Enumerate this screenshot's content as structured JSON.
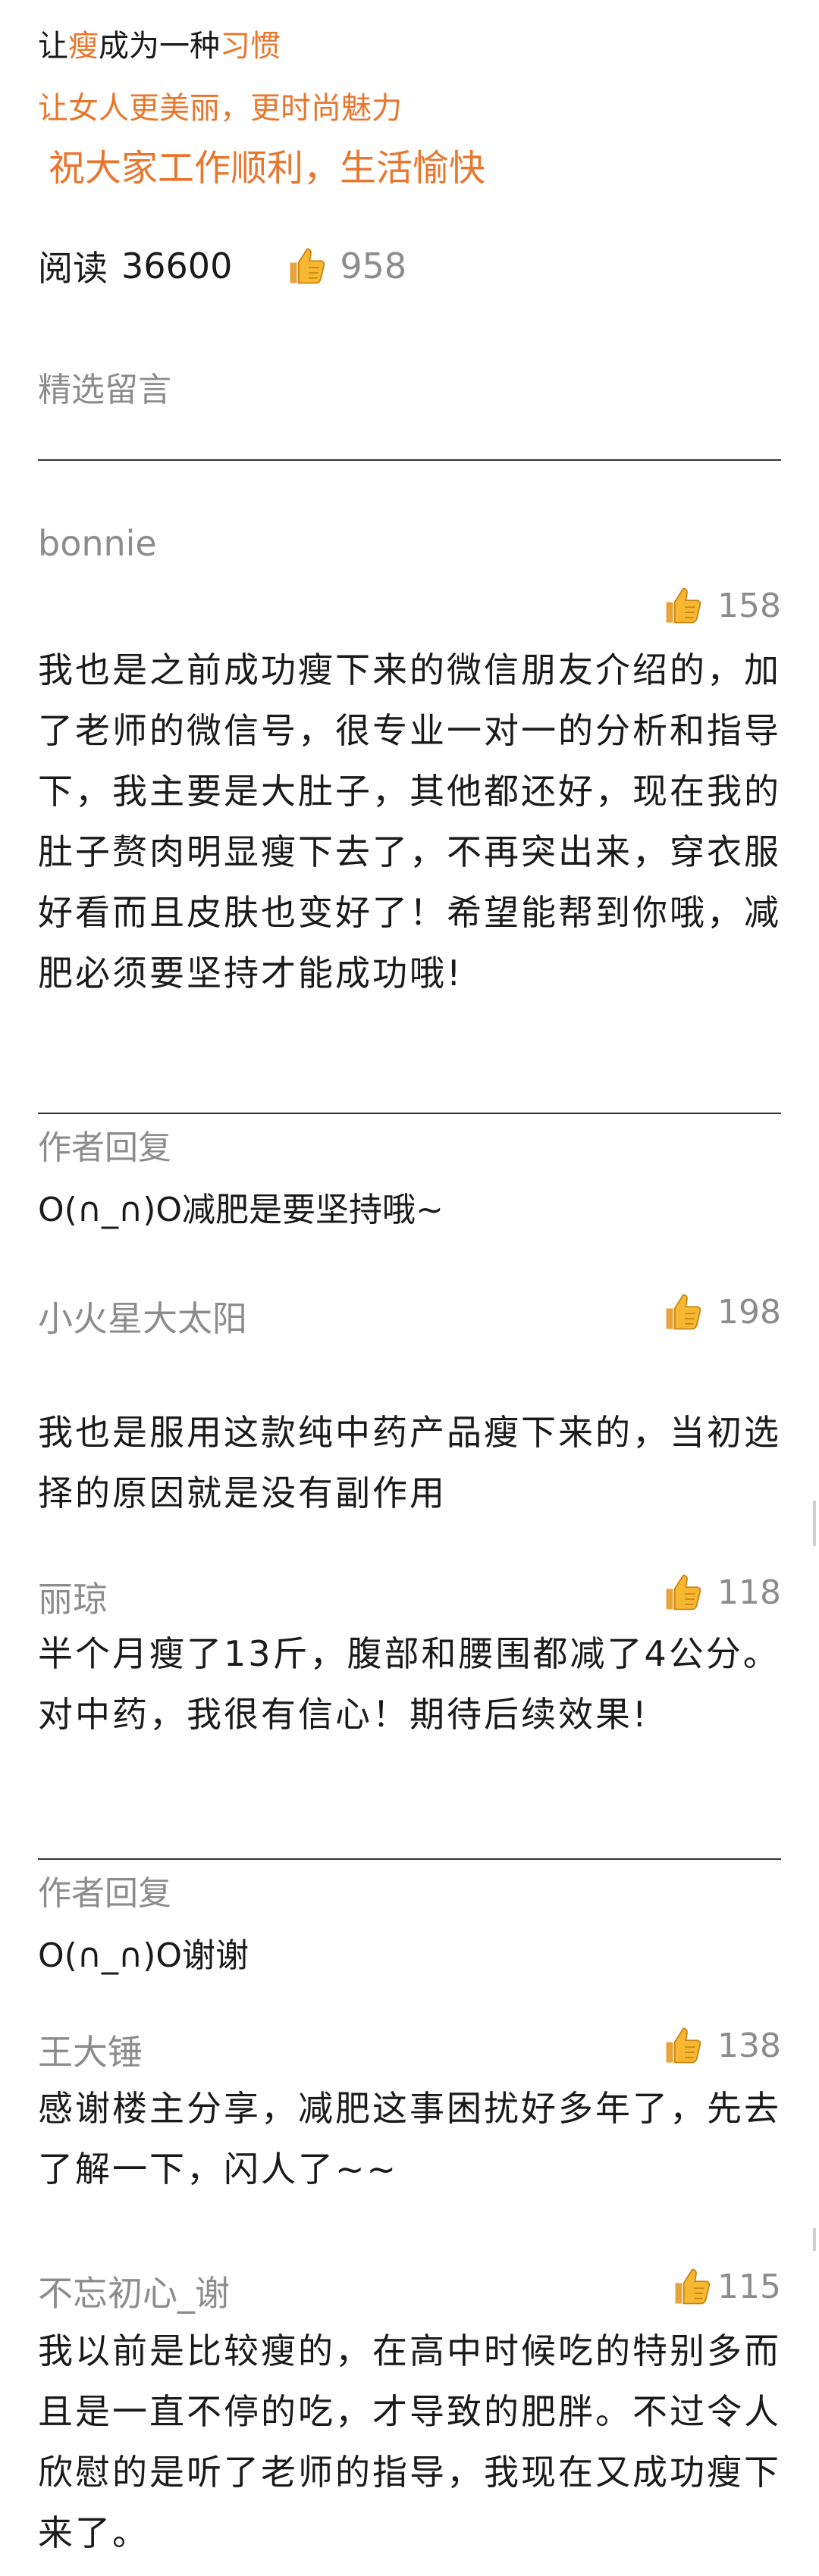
{
  "intro": {
    "line1": {
      "p1": "让",
      "p2": "瘦",
      "p3": "成为一种",
      "p4": "习惯"
    },
    "line2": "让女人更美丽，更时尚魅力",
    "line3": "祝大家工作顺利，生活愉快"
  },
  "stats": {
    "read_label": "阅读",
    "read_count": "36600",
    "like_count": "958"
  },
  "comments_header": "精选留言",
  "comments": [
    {
      "name": "bonnie",
      "likes": "158",
      "text": "我也是之前成功瘦下来的微信朋友介绍的，加了老师的微信号，很专业一对一的分析和指导下，我主要是大肚子，其他都还好，现在我的肚子赘肉明显瘦下去了，不再突出来，穿衣服好看而且皮肤也变好了！希望能帮到你哦，减肥必须要坚持才能成功哦!",
      "reply_label": "作者回复",
      "reply": "O(∩_∩)O减肥是要坚持哦~"
    },
    {
      "name": "小火星大太阳",
      "likes": "198",
      "text": "我也是服用这款纯中药产品瘦下来的，当初选择的原因就是没有副作用"
    },
    {
      "name": "丽琼",
      "likes": "118",
      "text": "半个月瘦了13斤，腹部和腰围都减了4公分。对中药，我很有信心！期待后续效果!",
      "reply_label": "作者回复",
      "reply": "O(∩_∩)O谢谢"
    },
    {
      "name": "王大锤",
      "likes": "138",
      "text": "感谢楼主分享，减肥这事困扰好多年了，先去了解一下，闪人了~~"
    },
    {
      "name": "不忘初心_谢",
      "likes": "115",
      "text": "我以前是比较瘦的，在高中时候吃的特别多而且是一直不停的吃，才导致的肥胖。不过令人欣慰的是听了老师的指导，我现在又成功瘦下来了。"
    }
  ],
  "colors": {
    "accent": "#e8772e",
    "muted": "#8c8c8c",
    "thumb": "#f5a623"
  }
}
